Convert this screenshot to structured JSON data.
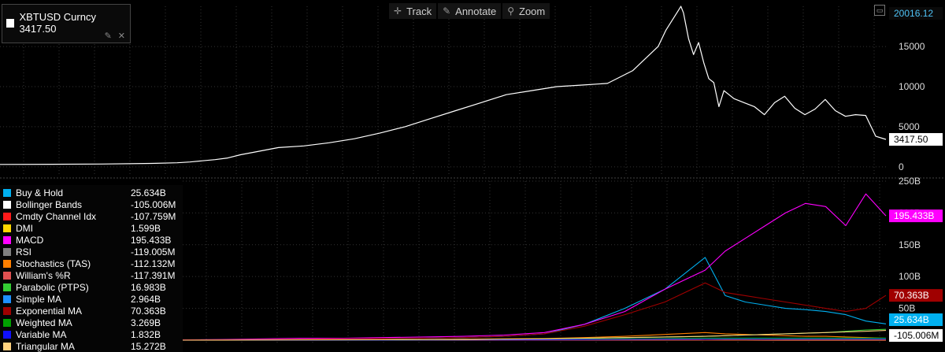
{
  "toolbar": {
    "track_label": "Track",
    "annotate_label": "Annotate",
    "zoom_label": "Zoom"
  },
  "security": {
    "label": "XBTUSD Curncy 3417.50"
  },
  "icons": [
    "crosshair-icon",
    "pencil-icon",
    "magnifier-icon",
    "pin-icon",
    "close-icon",
    "maximize-icon"
  ],
  "colors": {
    "background": "#000000",
    "price_line": "#ffffff",
    "grid": "#3a3a3a"
  },
  "chart_data": [
    {
      "type": "line",
      "title": "",
      "ylim": [
        -1000,
        20016.12
      ],
      "yticks": [
        0,
        5000,
        10000,
        15000
      ],
      "ytick_labels": [
        "0",
        "5000",
        "10000",
        "15000"
      ],
      "max_label": "20016.12",
      "last_label": "3417.50",
      "grid": true,
      "x": [
        0,
        20,
        40,
        60,
        70,
        75,
        80,
        85,
        90,
        95,
        100,
        110,
        120,
        130,
        140,
        150,
        160,
        170,
        180,
        190,
        200,
        210,
        220,
        230,
        240,
        250,
        260,
        263,
        266,
        268,
        269,
        270,
        272,
        274,
        276,
        278,
        280,
        282,
        284,
        286,
        290,
        294,
        298,
        302,
        306,
        310,
        314,
        318,
        322,
        326,
        330,
        334,
        338,
        342,
        346,
        350
      ],
      "series": [
        {
          "values": [
            300,
            320,
            350,
            420,
            500,
            600,
            750,
            900,
            1100,
            1500,
            1800,
            2400,
            2600,
            3000,
            3500,
            4200,
            5000,
            6000,
            7000,
            8000,
            9000,
            9500,
            10000,
            10200,
            10400,
            12000,
            15000,
            17000,
            18500,
            19500,
            20016,
            19200,
            16000,
            14000,
            15500,
            13000,
            11000,
            10500,
            7500,
            9500,
            8500,
            8000,
            7500,
            6500,
            8000,
            8800,
            7300,
            6500,
            7200,
            8400,
            7000,
            6300,
            6500,
            6400,
            3800,
            3417.5
          ]
        }
      ]
    },
    {
      "type": "line",
      "title": "",
      "ylim": [
        -5,
        250
      ],
      "yticks": [
        50,
        100,
        150,
        200,
        250
      ],
      "ytick_labels": [
        "50B",
        "100B",
        "150B",
        "200B",
        "250B"
      ],
      "grid": true,
      "x": [
        0,
        20,
        40,
        60,
        80,
        100,
        120,
        140,
        160,
        180,
        200,
        220,
        240,
        260,
        270,
        280,
        290,
        300,
        310,
        320,
        330,
        340,
        350
      ],
      "series": [
        {
          "name": "Buy & Hold",
          "color": "#00b0f0",
          "value_label": "25.634B",
          "values": [
            0.3,
            0.6,
            1,
            1.5,
            2,
            2.5,
            3,
            4,
            6,
            10,
            25,
            50,
            80,
            130,
            70,
            60,
            55,
            50,
            48,
            45,
            40,
            30,
            25.6
          ]
        },
        {
          "name": "Bollinger Bands",
          "color": "#ffffff",
          "value_label": "-105.006M",
          "values": [
            0,
            0,
            0,
            -0.05,
            -0.05,
            -0.05,
            -0.05,
            -0.06,
            -0.06,
            -0.07,
            -0.08,
            -0.08,
            -0.09,
            -0.09,
            -0.1,
            -0.1,
            -0.1,
            -0.1,
            -0.1,
            -0.1,
            -0.1,
            -0.1,
            -0.105
          ]
        },
        {
          "name": "Cmdty Channel Idx",
          "color": "#ff1a1a",
          "value_label": "-107.759M",
          "values": [
            0,
            0,
            0,
            -0.05,
            -0.05,
            -0.05,
            -0.06,
            -0.06,
            -0.07,
            -0.07,
            -0.08,
            -0.08,
            -0.09,
            -0.09,
            -0.1,
            -0.1,
            -0.1,
            -0.1,
            -0.1,
            -0.1,
            -0.11,
            -0.11,
            -0.108
          ]
        },
        {
          "name": "DMI",
          "color": "#ffd700",
          "value_label": "1.599B",
          "values": [
            0,
            0,
            0.05,
            0.1,
            0.1,
            0.2,
            0.2,
            0.3,
            0.4,
            0.6,
            0.8,
            1.2,
            1.5,
            1.8,
            1.6,
            1.6,
            1.7,
            1.6,
            1.5,
            1.6,
            1.6,
            1.6,
            1.599
          ]
        },
        {
          "name": "MACD",
          "color": "#ff00ff",
          "value_label": "195.433B",
          "values": [
            0.5,
            1,
            2,
            3,
            3,
            4,
            5,
            6,
            8,
            12,
            25,
            45,
            80,
            110,
            140,
            160,
            180,
            200,
            215,
            210,
            180,
            230,
            195.4
          ]
        },
        {
          "name": "RSI",
          "color": "#808080",
          "value_label": "-119.005M",
          "values": [
            0,
            0,
            0,
            -0.05,
            -0.05,
            -0.05,
            -0.06,
            -0.07,
            -0.07,
            -0.08,
            -0.09,
            -0.1,
            -0.1,
            -0.11,
            -0.11,
            -0.11,
            -0.12,
            -0.12,
            -0.12,
            -0.12,
            -0.12,
            -0.12,
            -0.119
          ]
        },
        {
          "name": "Stochastics (TAS)",
          "color": "#ff7f00",
          "value_label": "-112.132M",
          "values": [
            0,
            0,
            0.3,
            0.6,
            0.5,
            0.8,
            1,
            1.5,
            2,
            2.5,
            4,
            6,
            9,
            12,
            10,
            9,
            8,
            7,
            6,
            6,
            5,
            4,
            3
          ]
        },
        {
          "name": "William's %R",
          "color": "#e05050",
          "value_label": "-117.391M",
          "values": [
            0,
            0,
            0,
            -0.05,
            -0.05,
            -0.06,
            -0.06,
            -0.07,
            -0.08,
            -0.08,
            -0.09,
            -0.1,
            -0.1,
            -0.11,
            -0.11,
            -0.11,
            -0.12,
            -0.12,
            -0.12,
            -0.12,
            -0.12,
            -0.12,
            -0.117
          ]
        },
        {
          "name": "Parabolic (PTPS)",
          "color": "#33cc33",
          "value_label": "16.983B",
          "values": [
            0,
            0.1,
            0.2,
            0.3,
            0.4,
            0.6,
            0.8,
            1,
            1.5,
            2,
            3,
            4,
            5,
            6,
            7,
            8,
            9,
            10,
            11,
            12,
            14,
            16,
            16.98
          ]
        },
        {
          "name": "Simple MA",
          "color": "#1e90ff",
          "value_label": "2.964B",
          "values": [
            0,
            0,
            0.1,
            0.1,
            0.2,
            0.3,
            0.4,
            0.5,
            0.8,
            1,
            1.5,
            2,
            2.5,
            3,
            3,
            3,
            3,
            3,
            3,
            3,
            3,
            3,
            2.964
          ]
        },
        {
          "name": "Exponential MA",
          "color": "#a00000",
          "value_label": "70.363B",
          "values": [
            0.3,
            0.6,
            1,
            1.5,
            2,
            2.5,
            3,
            4,
            6,
            10,
            22,
            40,
            60,
            90,
            75,
            70,
            65,
            60,
            55,
            50,
            45,
            50,
            70.36
          ]
        },
        {
          "name": "Weighted MA",
          "color": "#00a000",
          "value_label": "3.269B",
          "values": [
            0,
            0,
            0.1,
            0.2,
            0.2,
            0.3,
            0.4,
            0.6,
            0.8,
            1,
            1.5,
            2,
            2.6,
            3.2,
            3.3,
            3.3,
            3.3,
            3.3,
            3.3,
            3.3,
            3.3,
            3.3,
            3.269
          ]
        },
        {
          "name": "Variable MA",
          "color": "#1010ff",
          "value_label": "1.832B",
          "values": [
            0,
            0,
            0.1,
            0.1,
            0.2,
            0.2,
            0.3,
            0.4,
            0.5,
            0.7,
            0.9,
            1.2,
            1.5,
            1.8,
            1.8,
            1.8,
            1.8,
            1.8,
            1.8,
            1.8,
            1.8,
            1.8,
            1.832
          ]
        },
        {
          "name": "Triangular MA",
          "color": "#ffd27f",
          "value_label": "15.272B",
          "values": [
            0,
            0.1,
            0.2,
            0.3,
            0.4,
            0.6,
            0.8,
            1,
            1.5,
            2,
            3,
            4,
            5,
            6,
            7,
            8,
            9,
            10,
            11,
            12,
            13,
            14,
            15.27
          ]
        }
      ]
    }
  ]
}
